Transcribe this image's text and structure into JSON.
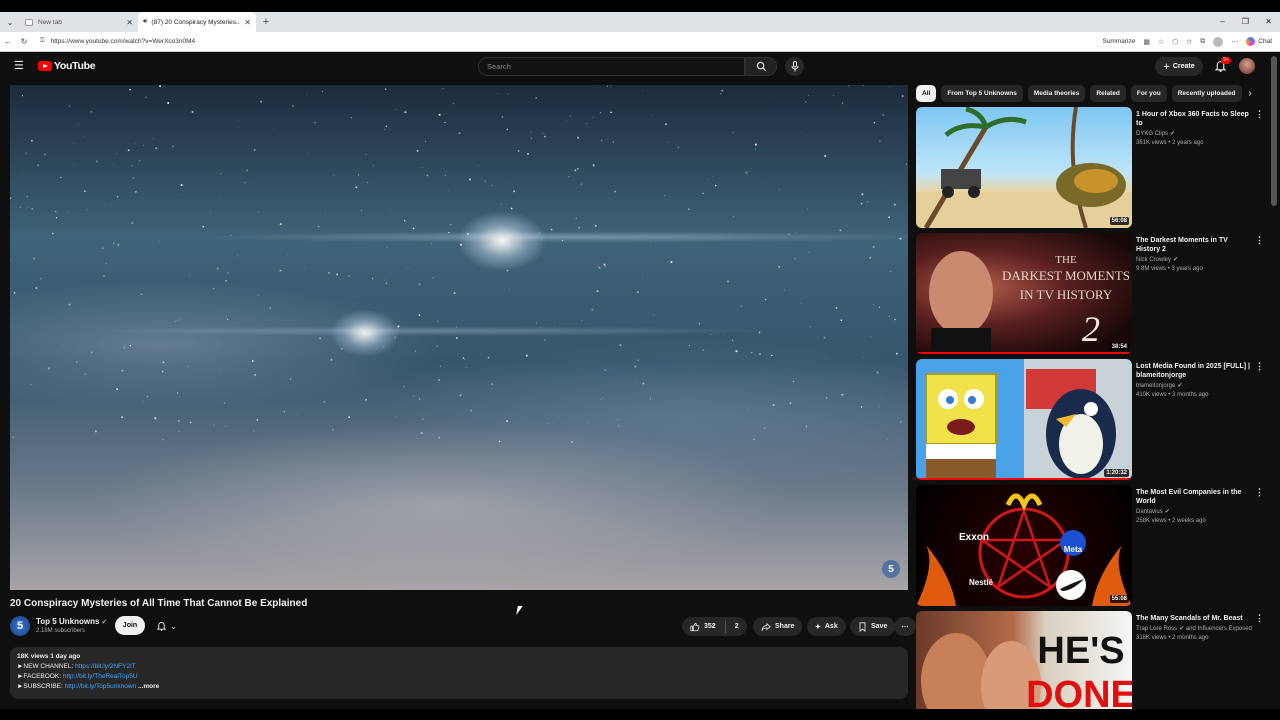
{
  "browser": {
    "tabs": [
      {
        "title": "New tab",
        "active": false
      },
      {
        "title": "(87) 20 Conspiracy Mysteries...",
        "active": true
      }
    ],
    "url": "https://www.youtube.com/watch?v=WerXco3n0M4",
    "summarize_label": "Summarize",
    "chat_label": "Chat"
  },
  "yt": {
    "logo_text": "YouTube",
    "search_placeholder": "Search",
    "create_label": "Create",
    "notif_badge": "9+"
  },
  "video": {
    "title": "20 Conspiracy Mysteries of All Time That Cannot Be Explained",
    "channel_name": "Top 5 Unknowns",
    "channel_avatar_text": "5",
    "subscribers": "2.18M subscribers",
    "join_label": "Join",
    "likes": "352",
    "dislikes": "2",
    "share_label": "Share",
    "ask_label": "Ask",
    "save_label": "Save",
    "description": {
      "meta": "18K views  1 day ago",
      "line1_label": "►NEW CHANNEL: ",
      "line1_link": "https://bit.ly/2NFY2IT",
      "line2_label": "►FACEBOOK: ",
      "line2_link": "http://bit.ly/TheRealTop5U",
      "line3_label": "►SUBSCRIBE: ",
      "line3_link": "http://bit.ly/Top5unknown",
      "more_label": "...more"
    }
  },
  "chips": [
    "All",
    "From Top 5 Unknowns",
    "Media theories",
    "Related",
    "For you",
    "Recently uploaded"
  ],
  "recommendations": [
    {
      "title": "1 Hour of Xbox 360 Facts to Sleep to",
      "channel": "DYKG Clips",
      "meta": "361K views • 2 years ago",
      "duration": "56:08",
      "watched": 0.0
    },
    {
      "title": "The Darkest Moments in TV History 2",
      "channel": "Nick Crowley",
      "meta": "9.8M views • 3 years ago",
      "duration": "38:54",
      "watched": 1.0,
      "thumb_text1": "THE",
      "thumb_text2": "DARKEST MOMENTS",
      "thumb_text3": "IN TV HISTORY",
      "thumb_text4": "2"
    },
    {
      "title": "Lost Media Found in 2025 [FULL] | blameitonjorge",
      "channel": "blameitonjorge",
      "meta": "410K views • 3 months ago",
      "duration": "1:20:32",
      "watched": 1.0
    },
    {
      "title": "The Most Evil Companies in the World",
      "channel": "Dantavius",
      "meta": "258K views • 2 weeks ago",
      "duration": "55:08",
      "watched": 0.0,
      "thumb_text1": "Exxon",
      "thumb_text2": "Meta",
      "thumb_text3": "Nestlé"
    },
    {
      "title": "The Many Scandals of Mr. Beast",
      "channel": "Trap Lore Ross",
      "channel_extra": "and Influencers Exposed",
      "meta": "318K views • 2 months ago",
      "duration": "",
      "watched": 0.0,
      "thumb_text1": "HE'S",
      "thumb_text2": "DONE"
    }
  ]
}
